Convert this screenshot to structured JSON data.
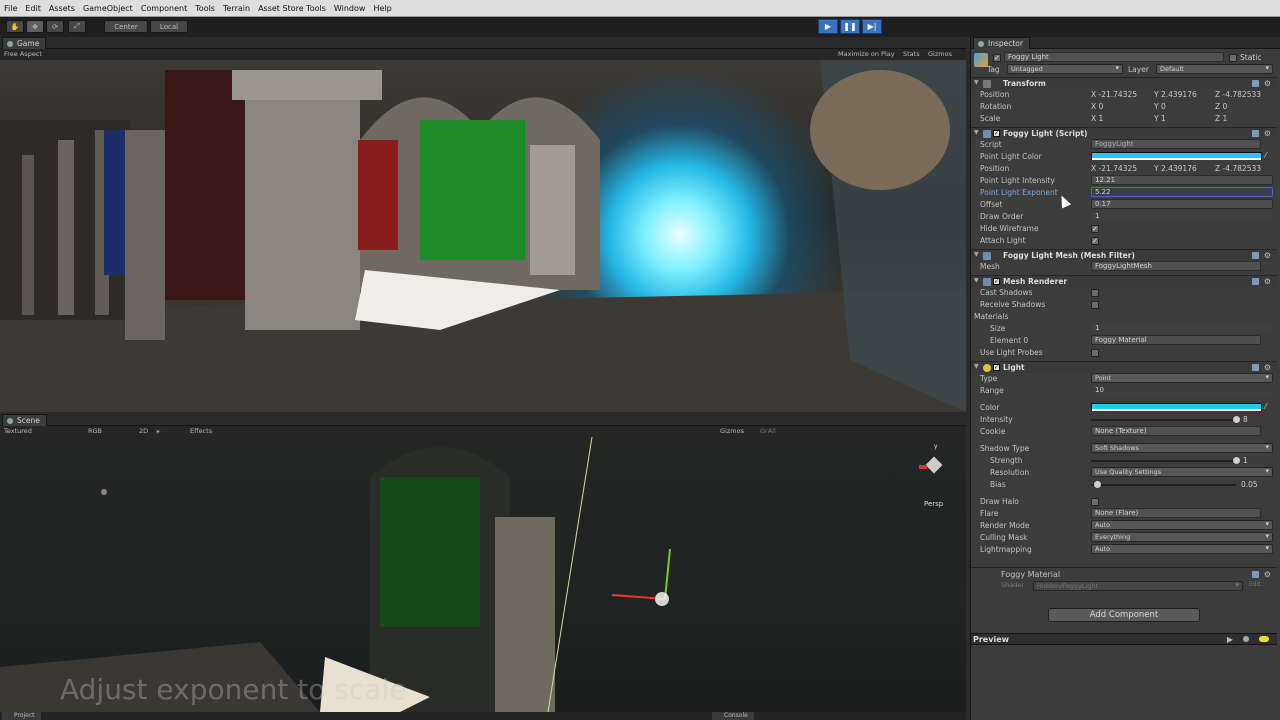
{
  "menu": [
    "File",
    "Edit",
    "Assets",
    "GameObject",
    "Component",
    "Tools",
    "Terrain",
    "Asset Store Tools",
    "Window",
    "Help"
  ],
  "toolbar": {
    "pivot_label": "Center",
    "space_label": "Local",
    "play_icon": "play-icon",
    "pause_icon": "pause-icon",
    "step_icon": "step-icon"
  },
  "game": {
    "tab_label": "Game",
    "aspect": "Free Aspect",
    "maximize": "Maximize on Play",
    "stats": "Stats",
    "gizmos": "Gizmos"
  },
  "scene": {
    "tab_label": "Scene",
    "shading": "Textured",
    "render": "RGB",
    "mode_2d": "2D",
    "effects": "Effects",
    "gizmos": "Gizmos",
    "search": "GrAll",
    "persp": "Persp",
    "axis_y": "y",
    "caption": "Adjust exponent to      scale"
  },
  "inspector": {
    "tab_label": "Inspector",
    "object_name": "Foggy Light",
    "static_label": "Static",
    "tag_label": "Tag",
    "tag_value": "Untagged",
    "layer_label": "Layer",
    "layer_value": "Default",
    "transform": {
      "title": "Transform",
      "position_label": "Position",
      "rotation_label": "Rotation",
      "scale_label": "Scale",
      "position": [
        "X -21.74325",
        "Y 2.439176",
        "Z -4.782533"
      ],
      "rotation": [
        "X 0",
        "Y 0",
        "Z 0"
      ],
      "scale": [
        "X 1",
        "Y 1",
        "Z 1"
      ]
    },
    "foggy_script": {
      "title": "Foggy Light (Script)",
      "script_label": "Script",
      "script_value": "FoggyLight",
      "color_label": "Point Light Color",
      "position_label": "Position",
      "position": [
        "X -21.74325",
        "Y 2.439176",
        "Z -4.782533"
      ],
      "intensity_label": "Point Light Intensity",
      "intensity_value": "12.21",
      "exponent_label": "Point Light Exponent",
      "exponent_value": "5.22",
      "offset_label": "Offset",
      "offset_value": "0.17",
      "draw_order_label": "Draw Order",
      "draw_order_value": "1",
      "hide_wireframe_label": "Hide Wireframe",
      "attach_light_label": "Attach Light"
    },
    "mesh_filter": {
      "title": "Foggy Light Mesh (Mesh Filter)",
      "mesh_label": "Mesh",
      "mesh_value": "FoggyLightMesh"
    },
    "mesh_renderer": {
      "title": "Mesh Renderer",
      "cast_label": "Cast Shadows",
      "receive_label": "Receive Shadows",
      "materials_label": "Materials",
      "size_label": "Size",
      "size_value": "1",
      "element_label": "Element 0",
      "element_value": "Foggy Material",
      "probes_label": "Use Light Probes"
    },
    "light": {
      "title": "Light",
      "type_label": "Type",
      "type_value": "Point",
      "range_label": "Range",
      "range_value": "10",
      "color_label": "Color",
      "intensity_label": "Intensity",
      "intensity_value": "8",
      "cookie_label": "Cookie",
      "cookie_value": "None (Texture)",
      "shadow_type_label": "Shadow Type",
      "shadow_type_value": "Soft Shadows",
      "strength_label": "Strength",
      "strength_value": "1",
      "resolution_label": "Resolution",
      "resolution_value": "Use Quality Settings",
      "bias_label": "Bias",
      "bias_value": "0.05",
      "halo_label": "Draw Halo",
      "flare_label": "Flare",
      "flare_value": "None (Flare)",
      "render_mode_label": "Render Mode",
      "render_mode_value": "Auto",
      "culling_label": "Culling Mask",
      "culling_value": "Everything",
      "lightmapping_label": "Lightmapping",
      "lightmapping_value": "Auto"
    },
    "material": {
      "name": "Foggy Material",
      "shader_label": "Shader",
      "shader_value": "Hidden/FoggyLight",
      "edit_label": "Edit..."
    },
    "add_component": "Add Component",
    "preview": "Preview"
  },
  "bottom_tabs": [
    "Project",
    "Console"
  ],
  "colors": {
    "light_color": "#22c7f3",
    "play_active": "#3a74c0"
  }
}
